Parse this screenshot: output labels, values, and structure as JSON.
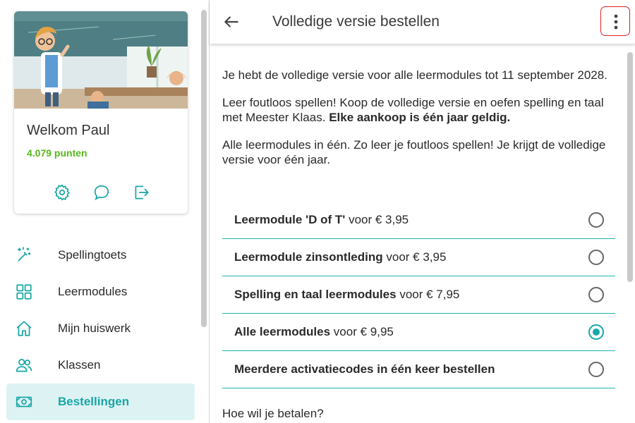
{
  "sidebar": {
    "welcome": "Welkom Paul",
    "points": "4.079 punten",
    "actions": [
      "settings-icon",
      "chat-icon",
      "logout-icon"
    ],
    "items": [
      {
        "label": "Spellingtoets",
        "icon": "magic-wand-icon"
      },
      {
        "label": "Leermodules",
        "icon": "grid-icon"
      },
      {
        "label": "Mijn huiswerk",
        "icon": "home-icon"
      },
      {
        "label": "Klassen",
        "icon": "users-icon"
      },
      {
        "label": "Bestellingen",
        "icon": "money-icon",
        "active": true
      }
    ]
  },
  "header": {
    "title": "Volledige versie bestellen",
    "back_icon": "arrow-left-icon",
    "more_icon": "more-vertical-icon"
  },
  "main": {
    "paragraphs": [
      "Je hebt de volledige versie voor alle leermodules tot 11 september 2028.",
      "Leer foutloos spellen! Koop de volledige versie en oefen spelling en taal met Meester Klaas.",
      "Alle leermodules in één. Zo leer je foutloos spellen! Je krijgt de volledige versie voor één jaar."
    ],
    "bold_note": "Elke aankoop is één jaar geldig.",
    "options": [
      {
        "name": "Leermodule 'D of T'",
        "price": "voor € 3,95",
        "selected": false
      },
      {
        "name": "Leermodule zinsontleding",
        "price": "voor € 3,95",
        "selected": false
      },
      {
        "name": "Spelling en taal leermodules",
        "price": "voor € 7,95",
        "selected": false
      },
      {
        "name": "Alle leermodules",
        "price": "voor € 9,95",
        "selected": true
      },
      {
        "name": "Meerdere activatiecodes in één keer bestellen",
        "price": "",
        "selected": false
      }
    ],
    "payment_question": "Hoe wil je betalen?"
  },
  "colors": {
    "accent": "#1aa6a6",
    "points": "#58b81a",
    "highlight": "#e02020"
  }
}
